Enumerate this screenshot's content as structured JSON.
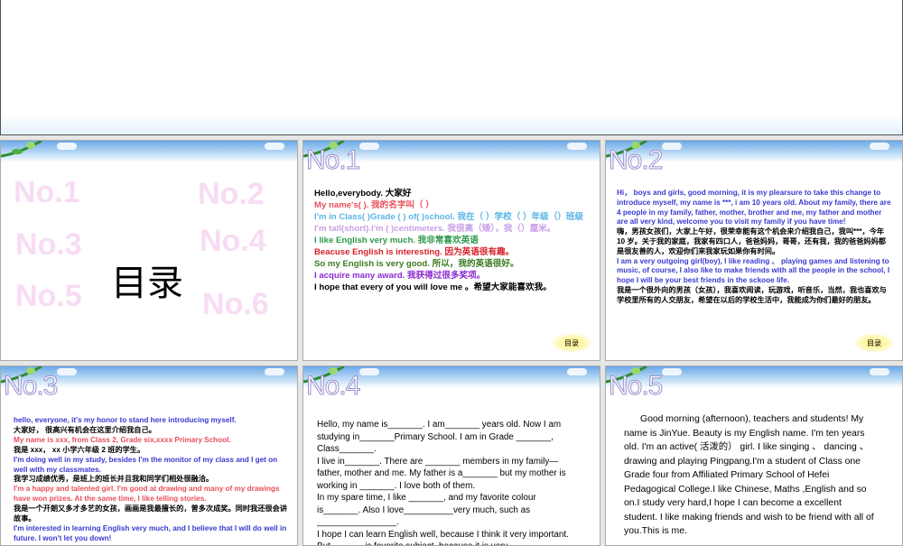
{
  "slides": [
    {
      "title": "目录",
      "watermarks": [
        "No.1",
        "No.2",
        "No.3",
        "No.4",
        "No.5",
        "No.6"
      ]
    },
    {
      "number": "No.1",
      "toc": "目录",
      "lines": [
        {
          "text": "Hello,everybody. 大家好",
          "color": "#000000"
        },
        {
          "text": "My name's(  ). 我的名字叫（ ）",
          "color": "#e8505a"
        },
        {
          "text": "I'm in Class( )Grade ( ) of( )school. 我在（  ）学校（ ）年级（）班级",
          "color": "#5ab4e6"
        },
        {
          "text": "I'm tall(short).I'm ( )centimeters. 我很高（矮），我（）厘米。",
          "color": "#c9a0e6"
        },
        {
          "text": "I like English very much. 我非常喜欢英语",
          "color": "#2e9a4a"
        },
        {
          "text": "Beacuse English is interesting. 因为英语很有趣。",
          "color": "#d8202a"
        },
        {
          "text": "So my English is very good. 所以，我的英语很好。",
          "color": "#3a7a20"
        },
        {
          "text": "I acquire many award. 我获得过很多奖项。",
          "color": "#8a2ad0"
        },
        {
          "text": "I hope that every of you will love me 。希望大家能喜欢我。",
          "color": "#000000"
        }
      ]
    },
    {
      "number": "No.2",
      "toc": "目录",
      "lines": [
        {
          "text": "Hi，   boys and girls, good morning, it is my plearsure to take this change to introduce myself, my name is ***, i am 10 years old. About my family, there are 4 people in my family, father, mother, brother and me, my father and mother are all very kind, welcome you to visit my family if you have time!",
          "color": "#3a3ad0"
        },
        {
          "text": "嗨，男孩女孩们，大家上午好，很荣幸能有这个机会来介绍我自己，我叫***，今年 10 岁。关于我的家庭，我家有四口人，爸爸妈妈，哥哥，还有我，我的爸爸妈妈都是很友善的人，欢迎你们来我家玩如果你有时间。",
          "color": "#000000"
        },
        {
          "text": "I am a very outgoing girl(boy), I like reading 、 playing games and listening to music, of course, I also like to make friends with all the people in the school, I hope I will be your best friends in the sckooe life.",
          "color": "#3a3ad0"
        },
        {
          "text": "我是一个很外向的男孩（女孩），我喜欢阅读，玩游戏，听音乐，当然，我也喜欢与学校里所有的人交朋友，希望在以后的学校生活中，我能成为你们最好的朋友。",
          "color": "#000000"
        }
      ]
    },
    {
      "number": "No.3",
      "lines": [
        {
          "text": "hello, everyone, it's my honor to stand here introducing myself.",
          "color": "#3a3ad0"
        },
        {
          "text": "大家好，  很高兴有机会在这里介绍我自己。",
          "color": "#000000"
        },
        {
          "text": "My name is xxx, from Class 2, Grade six,xxxx Primary School.",
          "color": "#e8505a"
        },
        {
          "text": "我是 xxx，  xx 小学六年级 2 班的学生。",
          "color": "#000000"
        },
        {
          "text": "I'm doing well in my study, besides I'm the monitor of my class and I get on well with my classmates.",
          "color": "#3a3ad0"
        },
        {
          "text": "我学习成绩优秀，是班上的班长并且我和同学们相处很融洽。",
          "color": "#000000"
        },
        {
          "text": "I'm a happy and talented girl. I'm good at drawing and many of my drawings have won prizes. At the same time, I like telling stories.",
          "color": "#e8505a"
        },
        {
          "text": "我是一个开朗又多才多艺的女孩，画画是我最擅长的，曾多次成奖。同时我还很会讲故事。",
          "color": "#000000"
        },
        {
          "text": "I'm interested in learning English very much, and I believe that I will do well in future. I won't let you down!",
          "color": "#3a3ad0"
        }
      ]
    },
    {
      "number": "No.4",
      "paragraphs": [
        "Hello, my name is_______. I am_______ years old. Now I am studying in_______Primary School. I am in Grade _______, Class_______.",
        "I live in_______. There are _______ members in my family—father, mother and me. My father is a_______ but my mother is working in _______. I love both of them.",
        "In my spare time, I like _______, and my favorite colour is_______. Also I love__________very much, such as ________________.",
        "I hope I can learn English well, because I think it very important. But ______ is favorite subject, because it is very"
      ]
    },
    {
      "number": "No.5",
      "paragraphs": [
        "Good morning (afternoon), teachers and students! My name is JinYue. Beauty is my English name. I'm ten years old. I'm an active( 活泼的）  girl. I like singing 、 dancing 、 drawing and playing Pingpang.I'm a student of Class one Grade four from Affiliated Primary School of Hefei Pedagogical College.I like Chinese, Maths ,English and so on.I study very hard,I hope I can become a excellent student. I like making friends and wish to be friend with all of you.This is me."
      ]
    }
  ]
}
